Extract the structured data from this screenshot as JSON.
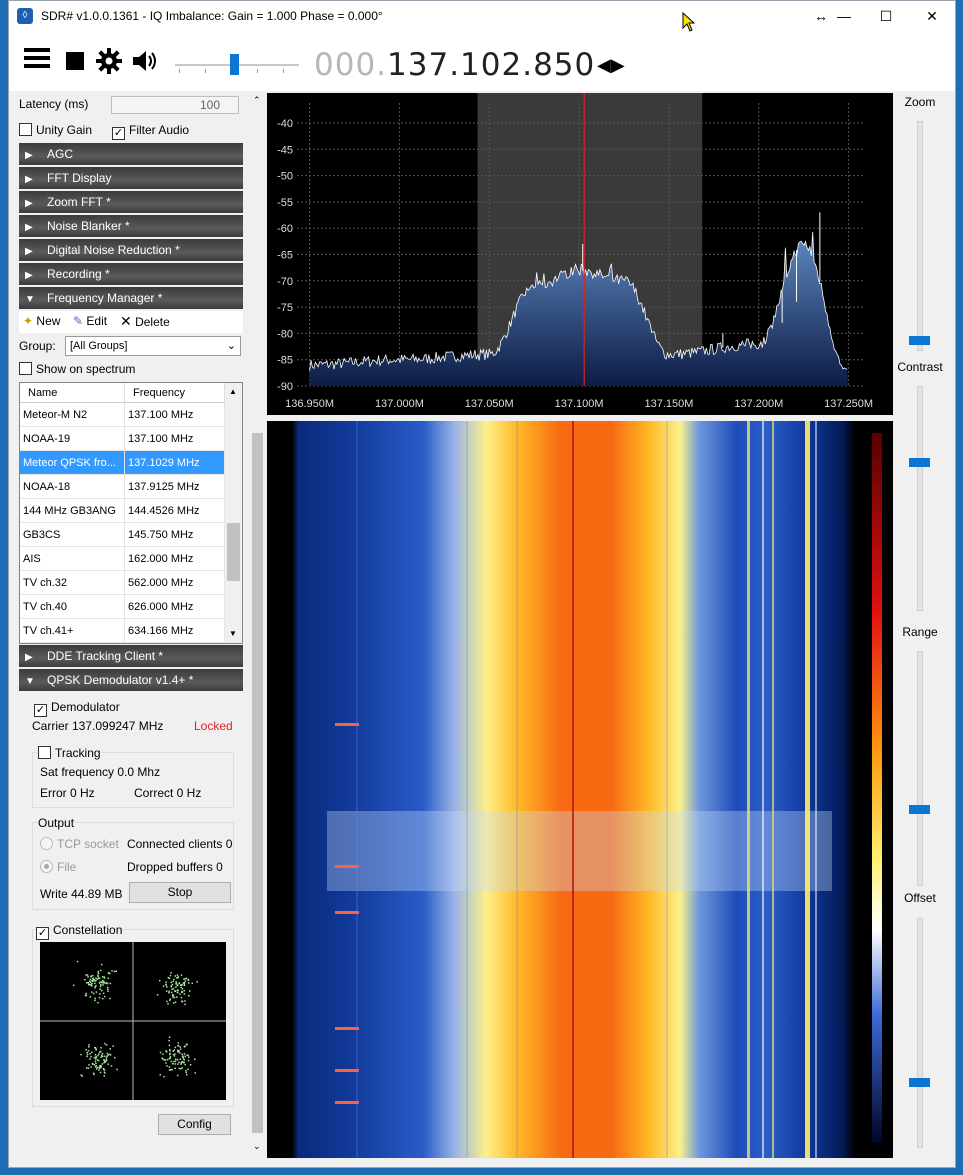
{
  "window": {
    "title": "SDR# v1.0.0.1361 - IQ Imbalance: Gain = 1.000 Phase = 0.000°",
    "controls": [
      "↔",
      "—",
      "☐",
      "✕"
    ]
  },
  "toolbar": {
    "menu_icon": "hamburger-menu-icon",
    "stop_icon": "stop-icon",
    "settings_icon": "gear-icon",
    "audio_icon": "speaker-icon",
    "volume_level": 0.5,
    "frequency_prefix": "000.",
    "frequency_value": "137.102.850"
  },
  "audio": {
    "latency_label": "Latency (ms)",
    "latency_value": "100",
    "unity_gain_label": "Unity Gain",
    "unity_gain_checked": false,
    "filter_audio_label": "Filter Audio",
    "filter_audio_checked": true
  },
  "panels": [
    {
      "label": "AGC",
      "expanded": false
    },
    {
      "label": "FFT Display",
      "expanded": false
    },
    {
      "label": "Zoom FFT *",
      "expanded": false
    },
    {
      "label": "Noise Blanker *",
      "expanded": false
    },
    {
      "label": "Digital Noise Reduction *",
      "expanded": false
    },
    {
      "label": "Recording *",
      "expanded": false
    },
    {
      "label": "Frequency Manager *",
      "expanded": true
    }
  ],
  "freq_manager": {
    "new_label": "New",
    "edit_label": "Edit",
    "delete_label": "Delete",
    "group_label": "Group:",
    "group_value": "[All Groups]",
    "show_on_spectrum_label": "Show on spectrum",
    "columns": [
      "Name",
      "Frequency"
    ],
    "rows": [
      {
        "name": "Meteor-M N2",
        "freq": "137.100 MHz",
        "selected": false
      },
      {
        "name": "NOAA-19",
        "freq": "137.100 MHz",
        "selected": false
      },
      {
        "name": "Meteor QPSK fro...",
        "freq": "137.1029 MHz",
        "selected": true
      },
      {
        "name": "NOAA-18",
        "freq": "137.9125 MHz",
        "selected": false
      },
      {
        "name": "144 MHz GB3ANG",
        "freq": "144.4526 MHz",
        "selected": false
      },
      {
        "name": "GB3CS",
        "freq": "145.750 MHz",
        "selected": false
      },
      {
        "name": "AIS",
        "freq": "162.000 MHz",
        "selected": false
      },
      {
        "name": "TV ch.32",
        "freq": "562.000 MHz",
        "selected": false
      },
      {
        "name": "TV ch.40",
        "freq": "626.000 MHz",
        "selected": false
      },
      {
        "name": "TV ch.41+",
        "freq": "634.166 MHz",
        "selected": false
      }
    ]
  },
  "panels_after": [
    {
      "label": "DDE Tracking Client *",
      "expanded": false
    },
    {
      "label": "QPSK Demodulator v1.4+ *",
      "expanded": true
    }
  ],
  "qpsk": {
    "demodulator_label": "Demodulator",
    "demodulator_checked": true,
    "carrier_text": "Carrier 137.099247 MHz",
    "lock_status": "Locked",
    "lock_color": "#e0202a",
    "tracking_label": "Tracking",
    "sat_freq_text": "Sat frequency 0.0 Mhz",
    "error_text": "Error 0 Hz",
    "correct_text": "Correct 0 Hz",
    "output_label": "Output",
    "tcp_label": "TCP socket",
    "connected_text": "Connected clients 0",
    "file_label": "File",
    "dropped_text": "Dropped buffers 0",
    "write_text": "Write 44.89 MB",
    "stop_label": "Stop",
    "constellation_label": "Constellation",
    "constellation_checked": true,
    "config_label": "Config"
  },
  "spectrum": {
    "y_ticks": [
      "-40",
      "-45",
      "-50",
      "-55",
      "-60",
      "-65",
      "-70",
      "-75",
      "-80",
      "-85",
      "-90"
    ],
    "x_ticks": [
      "136.950M",
      "137.000M",
      "137.050M",
      "137.100M",
      "137.150M",
      "137.200M",
      "137.250M"
    ],
    "accent": "#e02020"
  },
  "right_panel": {
    "zoom_label": "Zoom",
    "contrast_label": "Contrast",
    "range_label": "Range",
    "offset_label": "Offset"
  },
  "chart_data": {
    "type": "line",
    "x": [
      136.95,
      137.0,
      137.05,
      137.075,
      137.1,
      137.125,
      137.15,
      137.2,
      137.225,
      137.25
    ],
    "values": [
      -86,
      -85,
      -84,
      -71,
      -68,
      -70,
      -84,
      -82,
      -63,
      -88
    ],
    "xlabel": "",
    "ylabel": "",
    "ylim": [
      -90,
      -40
    ],
    "xlim": [
      136.943,
      137.258
    ],
    "grid": true
  }
}
